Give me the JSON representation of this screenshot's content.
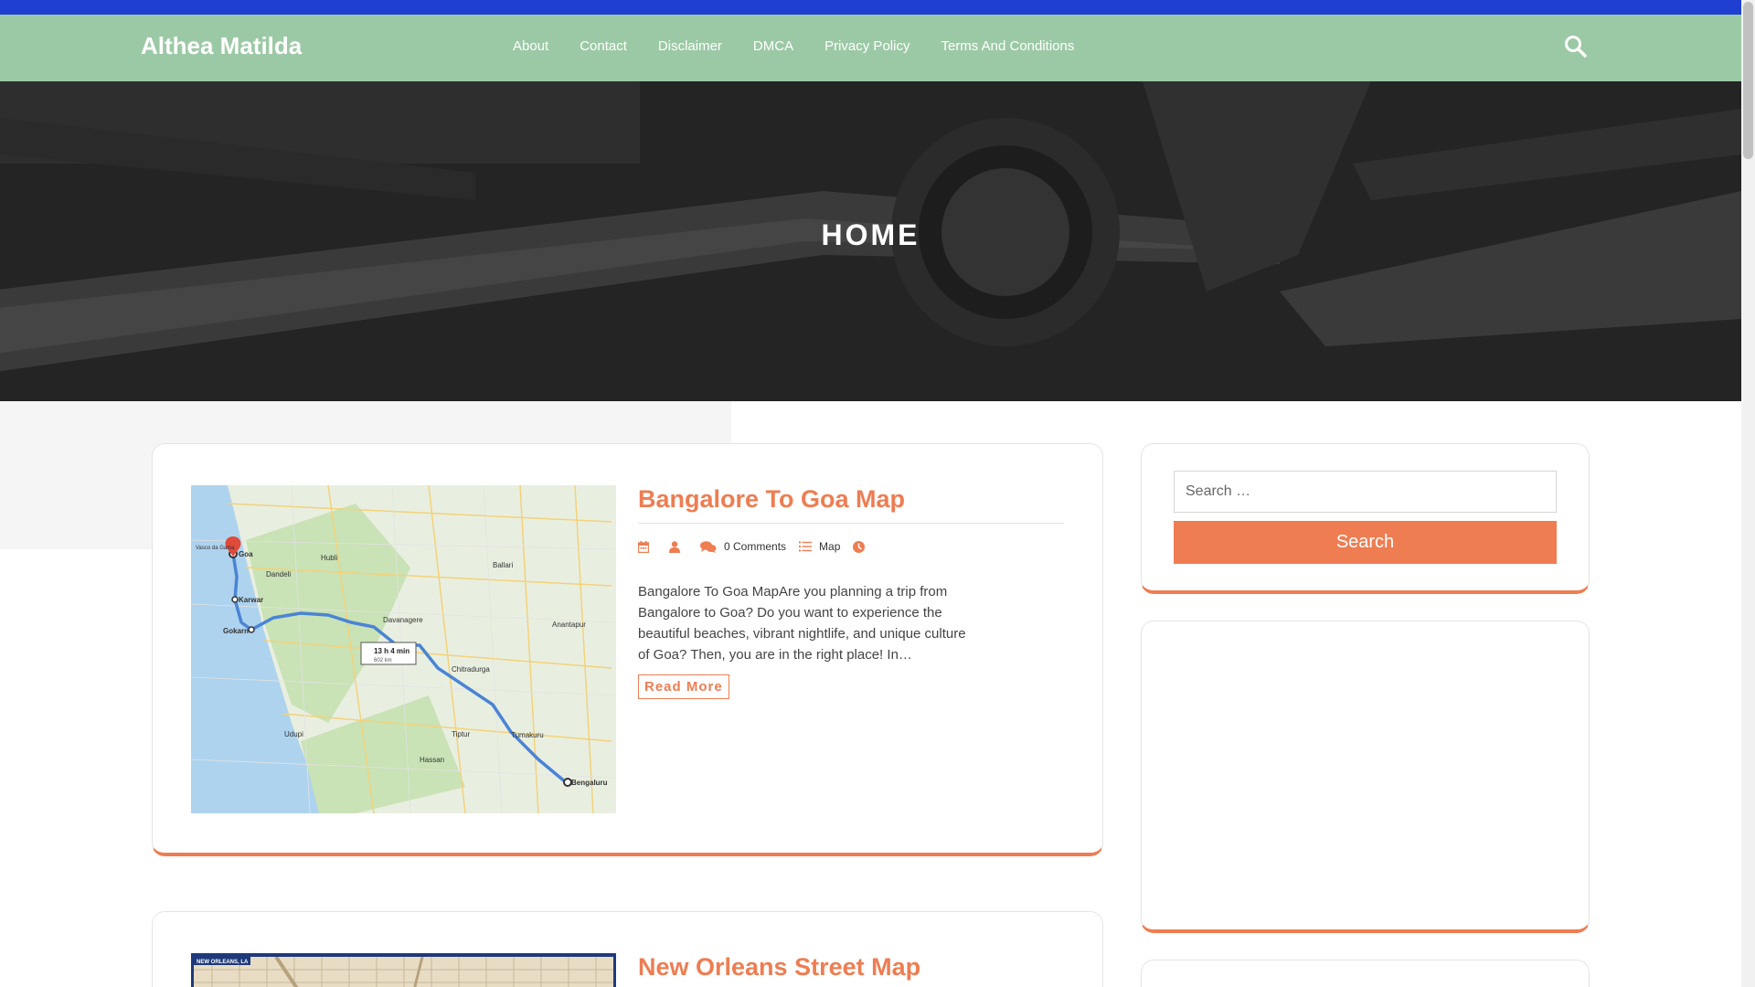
{
  "site": {
    "title": "Althea Matilda"
  },
  "nav": {
    "items": [
      "About",
      "Contact",
      "Disclaimer",
      "DMCA",
      "Privacy Policy",
      "Terms And Conditions"
    ]
  },
  "hero": {
    "title": "HOME"
  },
  "posts": [
    {
      "title": "Bangalore To Goa Map",
      "comments": "0 Comments",
      "category": "Map",
      "excerpt": "Bangalore To Goa MapAre you planning a trip from Bangalore to Goa? Do you want to experience the beautiful beaches, vibrant nightlife, and unique culture of Goa? Then, you are in the right place! In…",
      "read_more": "Read More",
      "map_labels": {
        "goa": "Goa",
        "karwar": "Karwar",
        "gokarn": "Gokarn",
        "bengaluru": "Bengaluru",
        "hubli": "Hubli",
        "dandeli": "Dandeli",
        "davanagere": "Davanagere",
        "hassan": "Hassan",
        "udupi": "Udupi",
        "tiptur": "Tiptur",
        "tumakuru": "Tumakuru",
        "chitradurga": "Chitradurga",
        "ballari": "Ballari",
        "anantapur": "Anantapur",
        "vasco": "Vasco da Gama",
        "duration": "13 h 4 min",
        "distance": "602 km"
      }
    },
    {
      "title": "New Orleans Street Map",
      "thumb_label": "NEW ORLEANS, LA"
    }
  ],
  "sidebar": {
    "search_placeholder": "Search …",
    "search_button": "Search"
  },
  "colors": {
    "accent": "#ee7d52",
    "header": "#9cc9a5",
    "topbar": "#1f3fd1"
  },
  "icons": [
    "search-icon",
    "calendar-icon",
    "user-icon",
    "comments-icon",
    "list-icon",
    "clock-icon"
  ]
}
